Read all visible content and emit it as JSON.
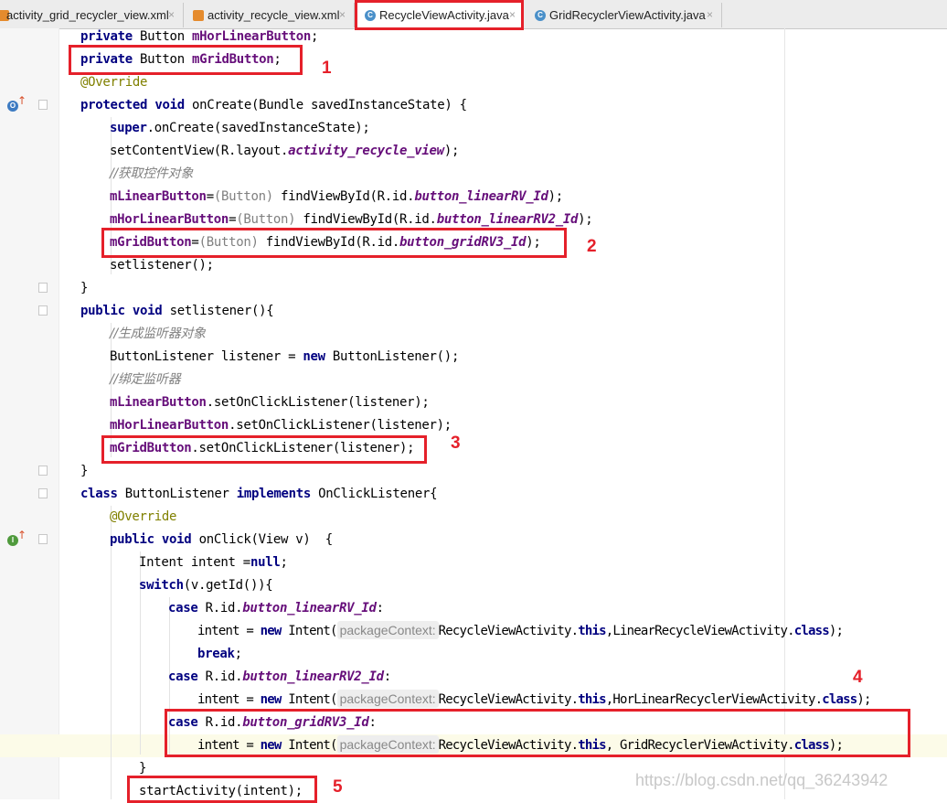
{
  "tabs": [
    {
      "label": "activity_grid_recycler_view.xml",
      "close": "×",
      "icon": "xml-file-icon",
      "active": false
    },
    {
      "label": "activity_recycle_view.xml",
      "close": "×",
      "icon": "xml-file-icon",
      "active": false
    },
    {
      "label": "RecycleViewActivity.java",
      "close": "×",
      "icon": "java-class-icon",
      "active": true
    },
    {
      "label": "GridRecyclerViewActivity.java",
      "close": "×",
      "icon": "java-class-icon",
      "active": false
    }
  ],
  "code": {
    "l1": {
      "kw": "private",
      "type": "Button",
      "field": "mHorLinearButton",
      "end": ";"
    },
    "l2": {
      "kw": "private",
      "type": "Button",
      "field": "mGridButton",
      "end": ";"
    },
    "l3": "@Override",
    "l4": {
      "kw1": "protected",
      "kw2": "void",
      "rest": "onCreate(Bundle savedInstanceState) {"
    },
    "l5": {
      "kw": "super",
      "rest": ".onCreate(savedInstanceState);"
    },
    "l6": {
      "a": "setContentView(R.layout.",
      "id": "activity_recycle_view",
      "b": ");"
    },
    "l7": "//获取控件对象",
    "l8": {
      "field": "mLinearButton",
      "eq": "=",
      "cast": "(Button)",
      "a": " findViewById(R.id.",
      "id": "button_linearRV_Id",
      "b": ");"
    },
    "l9": {
      "field": "mHorLinearButton",
      "eq": "=",
      "cast": "(Button)",
      "a": " findViewById(R.id.",
      "id": "button_linearRV2_Id",
      "b": ");"
    },
    "l10": {
      "field": "mGridButton",
      "eq": "=",
      "cast": "(Button)",
      "a": " findViewById(R.id.",
      "id": "button_gridRV3_Id",
      "b": ");"
    },
    "l11": "setlistener();",
    "l12": "}",
    "l13": {
      "kw1": "public",
      "kw2": "void",
      "rest": "setlistener(){"
    },
    "l14": "//生成监听器对象",
    "l15": {
      "a": "ButtonListener listener = ",
      "kw": "new",
      "b": " ButtonListener();"
    },
    "l16": "//绑定监听器",
    "l17": {
      "field": "mLinearButton",
      "rest": ".setOnClickListener(listener);"
    },
    "l18": {
      "field": "mHorLinearButton",
      "rest": ".setOnClickListener(listener);"
    },
    "l19": {
      "field": "mGridButton",
      "rest": ".setOnClickListener(listener);"
    },
    "l20": "}",
    "l21": {
      "kw1": "class",
      "a": " ButtonListener ",
      "kw2": "implements",
      "b": " OnClickListener{"
    },
    "l22": "@Override",
    "l23": {
      "kw1": "public",
      "kw2": "void",
      "rest": "onClick(View v)  {"
    },
    "l24": {
      "a": "Intent intent =",
      "kw": "null",
      "b": ";"
    },
    "l25": {
      "kw": "switch",
      "rest": "(v.getId()){"
    },
    "l26": {
      "kw": "case",
      "a": " R.id.",
      "id": "button_linearRV_Id",
      "b": ":"
    },
    "l27": {
      "a": "intent = ",
      "kw": "new",
      "b": " Intent(",
      "hint": "packageContext:",
      "c": "RecycleViewActivity.",
      "this": "this",
      "d": ",LinearRecycleViewActivity.",
      "cls": "class",
      "e": ");"
    },
    "l28": {
      "kw": "break",
      "b": ";"
    },
    "l29": {
      "kw": "case",
      "a": " R.id.",
      "id": "button_linearRV2_Id",
      "b": ":"
    },
    "l30": {
      "a": "intent = ",
      "kw": "new",
      "b": " Intent(",
      "hint": "packageContext:",
      "c": "RecycleViewActivity.",
      "this": "this",
      "d": ",HorLinearRecyclerViewActivity.",
      "cls": "class",
      "e": ");"
    },
    "l31": {
      "kw": "case",
      "a": " R.id.",
      "id": "button_gridRV3_Id",
      "b": ":"
    },
    "l32": {
      "a": "intent = ",
      "kw": "new",
      "b": " Intent(",
      "hint": "packageContext:",
      "c": "RecycleViewActivity.",
      "this": "this",
      "d": ", GridRecyclerViewActivity.",
      "cls": "class",
      "e": ");"
    },
    "l33": "}",
    "l34": "startActivity(intent);"
  },
  "annotations": {
    "n1": "1",
    "n2": "2",
    "n3": "3",
    "n4": "4",
    "n5": "5"
  },
  "gutter_icons": {
    "override": "O",
    "implement": "I"
  },
  "colors": {
    "highlight": "#e5202a",
    "keyword": "#000080",
    "field": "#660e7a",
    "comment": "#808080",
    "annotation": "#808000"
  },
  "watermark": "https://blog.csdn.net/qq_36243942"
}
